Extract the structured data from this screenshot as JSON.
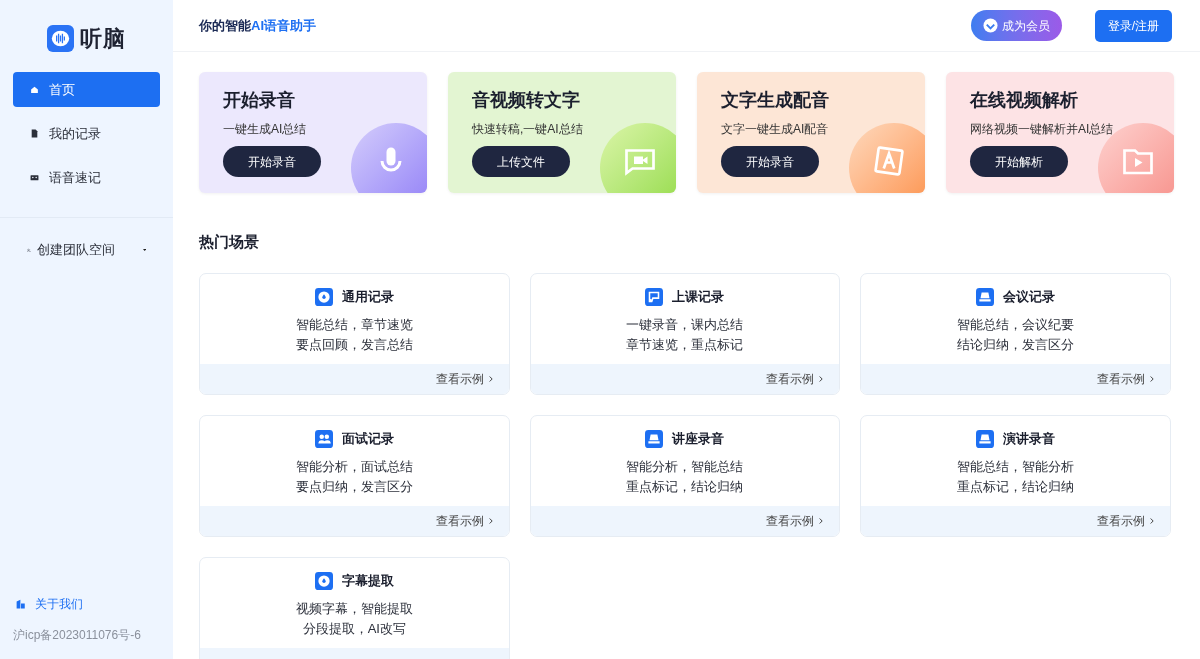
{
  "logo": {
    "name": "听脑"
  },
  "sidebar": {
    "items": [
      {
        "label": "首页",
        "kind": "home",
        "selected": true
      },
      {
        "label": "我的记录",
        "kind": "doc",
        "selected": false
      },
      {
        "label": "语音速记",
        "kind": "tape",
        "selected": false
      }
    ],
    "team_space": {
      "label": "创建团队空间"
    },
    "about": {
      "label": "关于我们"
    },
    "icp": "沪icp备2023011076号-6"
  },
  "header": {
    "tagline_prefix": "你的智能",
    "tagline_highlight": "AI语音助手",
    "member_button": "成为会员",
    "login_button": "登录/注册"
  },
  "feature_cards": [
    {
      "kind": "mic",
      "title": "开始录音",
      "subtitle": "一键生成AI总结",
      "button": "开始录音",
      "color": "#ece8fd"
    },
    {
      "kind": "video",
      "title": "音视频转文字",
      "subtitle": "快速转稿,一键AI总结",
      "button": "上传文件",
      "color": "#e3f5d2"
    },
    {
      "kind": "letter",
      "title": "文字生成配音",
      "subtitle": "文字一键生成AI配音",
      "button": "开始录音",
      "color": "#fde6d6"
    },
    {
      "kind": "folder",
      "title": "在线视频解析",
      "subtitle": "网络视频一键解析并AI总结",
      "button": "开始解析",
      "color": "#fde3e5"
    }
  ],
  "scenes": {
    "title": "热门场景",
    "cards": [
      {
        "kind": "drop",
        "title": "通用记录",
        "lines": [
          "智能总结，章节速览",
          "要点回顾，发言总结"
        ],
        "link": "查看示例"
      },
      {
        "kind": "board",
        "title": "上课记录",
        "lines": [
          "一键录音，课内总结",
          "章节速览，重点标记"
        ],
        "link": "查看示例"
      },
      {
        "kind": "table",
        "title": "会议记录",
        "lines": [
          "智能总结，会议纪要",
          "结论归纳，发言区分"
        ],
        "link": "查看示例"
      },
      {
        "kind": "people",
        "title": "面试记录",
        "lines": [
          "智能分析，面试总结",
          "要点归纳，发言区分"
        ],
        "link": "查看示例"
      },
      {
        "kind": "table",
        "title": "讲座录音",
        "lines": [
          "智能分析，智能总结",
          "重点标记，结论归纳"
        ],
        "link": "查看示例"
      },
      {
        "kind": "table",
        "title": "演讲录音",
        "lines": [
          "智能总结，智能分析",
          "重点标记，结论归纳"
        ],
        "link": "查看示例"
      },
      {
        "kind": "drop",
        "title": "字幕提取",
        "lines": [
          "视频字幕，智能提取",
          "分段提取，AI改写"
        ]
      }
    ]
  }
}
